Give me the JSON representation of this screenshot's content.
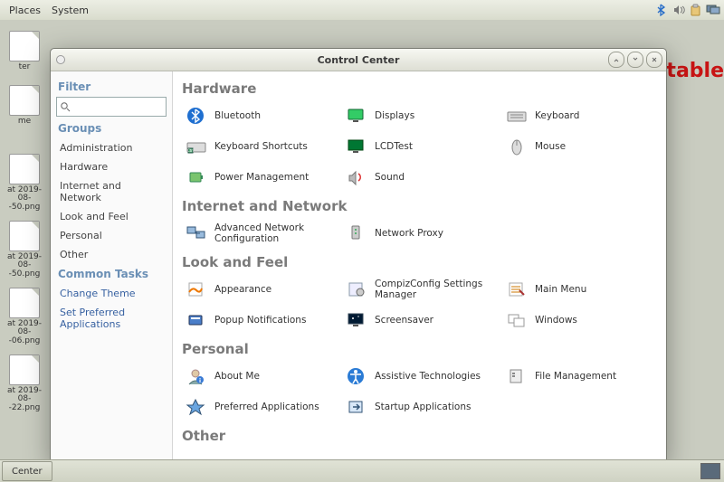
{
  "panel": {
    "places": "Places",
    "system": "System"
  },
  "desktop": {
    "icons": [
      {
        "label": "ter"
      },
      {
        "label": "me"
      },
      {
        "label": "at 2019-08-\n-50.png"
      },
      {
        "label": "at 2019-08-\n-50.png"
      },
      {
        "label": "at 2019-08-\n-06.png"
      },
      {
        "label": "at 2019-08-\n-22.png"
      }
    ],
    "red_label": "table"
  },
  "window": {
    "title": "Control Center",
    "sidebar": {
      "filter_header": "Filter",
      "groups_header": "Groups",
      "groups": [
        "Administration",
        "Hardware",
        "Internet and Network",
        "Look and Feel",
        "Personal",
        "Other"
      ],
      "tasks_header": "Common Tasks",
      "tasks": [
        "Change Theme",
        "Set Preferred Applications"
      ]
    },
    "sections": [
      {
        "header": "Hardware",
        "items": [
          {
            "key": "bluetooth",
            "label": "Bluetooth"
          },
          {
            "key": "displays",
            "label": "Displays"
          },
          {
            "key": "keyboard",
            "label": "Keyboard"
          },
          {
            "key": "kbshort",
            "label": "Keyboard Shortcuts"
          },
          {
            "key": "lcdtest",
            "label": "LCDTest"
          },
          {
            "key": "mouse",
            "label": "Mouse"
          },
          {
            "key": "power",
            "label": "Power Management"
          },
          {
            "key": "sound",
            "label": "Sound"
          }
        ]
      },
      {
        "header": "Internet and Network",
        "items": [
          {
            "key": "advnet",
            "label": "Advanced Network Configuration"
          },
          {
            "key": "proxy",
            "label": "Network Proxy"
          }
        ]
      },
      {
        "header": "Look and Feel",
        "items": [
          {
            "key": "appearance",
            "label": "Appearance"
          },
          {
            "key": "compiz",
            "label": "CompizConfig Settings Manager"
          },
          {
            "key": "mainmenu",
            "label": "Main Menu"
          },
          {
            "key": "popup",
            "label": "Popup Notifications"
          },
          {
            "key": "screensaver",
            "label": "Screensaver"
          },
          {
            "key": "windows",
            "label": "Windows"
          }
        ]
      },
      {
        "header": "Personal",
        "items": [
          {
            "key": "aboutme",
            "label": "About Me"
          },
          {
            "key": "assistive",
            "label": "Assistive Technologies"
          },
          {
            "key": "filemgmt",
            "label": "File Management"
          },
          {
            "key": "prefapps",
            "label": "Preferred Applications"
          },
          {
            "key": "startup",
            "label": "Startup Applications"
          }
        ]
      },
      {
        "header": "Other",
        "items": []
      }
    ]
  },
  "taskbar": {
    "btn": "Center"
  }
}
